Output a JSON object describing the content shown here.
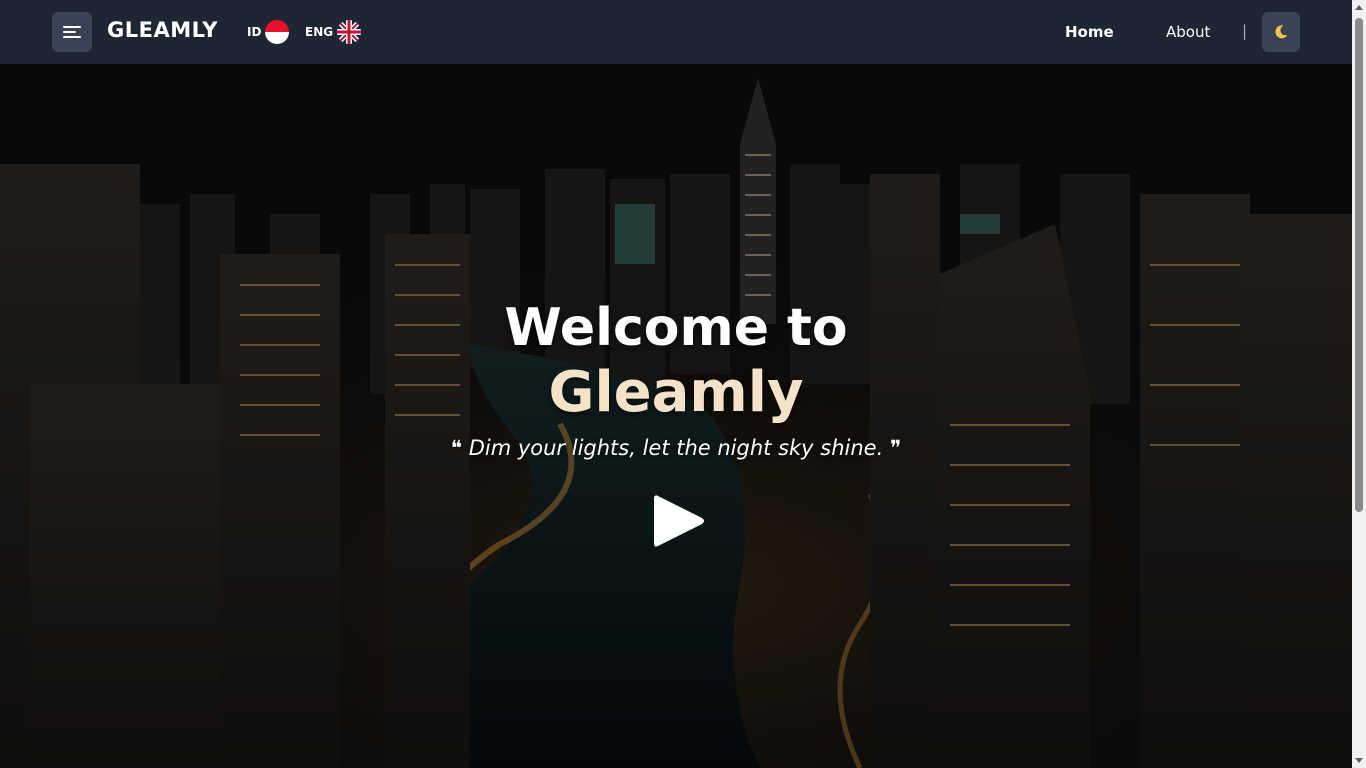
{
  "navbar": {
    "brand": "GLEAMLY",
    "menu_icon": "hamburger-menu-icon",
    "languages": [
      {
        "code": "ID",
        "flag_icon": "indonesia-flag-icon"
      },
      {
        "code": "ENG",
        "flag_icon": "uk-flag-icon"
      }
    ],
    "links": [
      {
        "label": "Home",
        "active": true
      },
      {
        "label": "About",
        "active": false
      }
    ],
    "separator": "|",
    "theme_icon": "moon-icon"
  },
  "hero": {
    "title_line1": "Welcome to",
    "title_line2": "Gleamly",
    "quote": "❝ Dim your lights, let the night sky shine. ❞",
    "play_icon": "play-icon"
  },
  "colors": {
    "navbar_bg": "#1e2533",
    "button_bg": "#3a4354",
    "accent_cream": "#f4e3c8"
  }
}
